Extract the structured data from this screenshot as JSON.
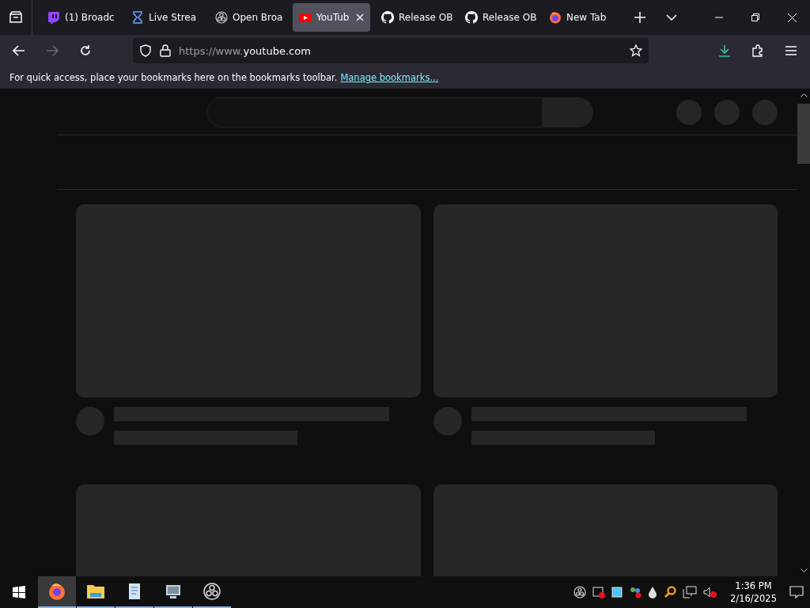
{
  "tabs": [
    {
      "label": "(1) Broadc",
      "kind": "twitch",
      "selected": false
    },
    {
      "label": "Live Strea",
      "kind": "hourglass",
      "selected": false
    },
    {
      "label": "Open Broa",
      "kind": "obs",
      "selected": false
    },
    {
      "label": "YouTub",
      "kind": "youtube",
      "selected": true
    },
    {
      "label": "Release OB",
      "kind": "github",
      "selected": false
    },
    {
      "label": "Release OB",
      "kind": "github",
      "selected": false
    },
    {
      "label": "New Tab",
      "kind": "firefox",
      "selected": false
    }
  ],
  "address_bar": {
    "scheme": "https://www.",
    "host": "youtube.com"
  },
  "bookmarks_bar": {
    "message": "For quick access, place your bookmarks here on the bookmarks toolbar.",
    "link": "Manage bookmarks..."
  },
  "taskbar": {
    "apps": [
      {
        "kind": "firefox",
        "selected": true
      },
      {
        "kind": "folder",
        "selected": false
      },
      {
        "kind": "notepad",
        "selected": false
      },
      {
        "kind": "monitor",
        "selected": false
      },
      {
        "kind": "obs",
        "selected": false
      }
    ],
    "time": "1:36 PM",
    "date": "2/16/2025"
  }
}
